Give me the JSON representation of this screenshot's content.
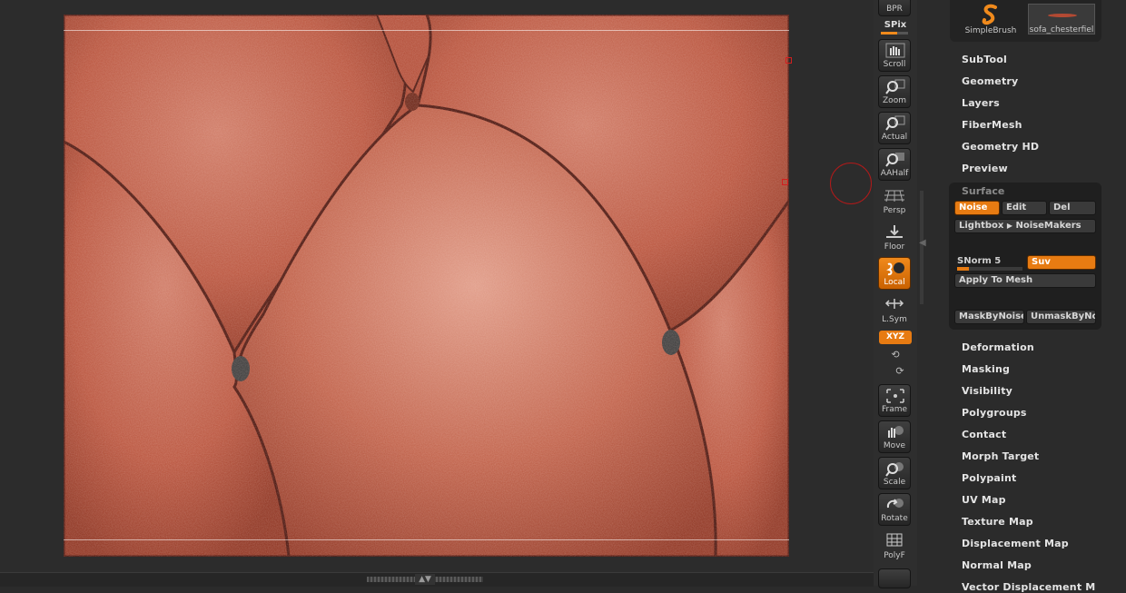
{
  "viewport": {
    "description_color": "#b8513a"
  },
  "shelf": {
    "bpr_label": "BPR",
    "spix_label": "SPix",
    "spix_level": 0.6,
    "buttons": [
      {
        "label": "Scroll",
        "icon": "hand-scroll-icon"
      },
      {
        "label": "Zoom",
        "icon": "magnifier-zoom-icon"
      },
      {
        "label": "Actual",
        "icon": "magnifier-actual-icon"
      },
      {
        "label": "AAHalf",
        "icon": "magnifier-aahalf-icon"
      },
      {
        "label": "Persp",
        "icon": "perspective-grid-icon"
      },
      {
        "label": "Floor",
        "icon": "floor-icon"
      },
      {
        "label": "Local",
        "icon": "local-transform-icon",
        "active": true
      },
      {
        "label": "L.Sym",
        "icon": "local-symmetry-icon"
      },
      {
        "label": "Frame",
        "icon": "frame-icon"
      },
      {
        "label": "Move",
        "icon": "hand-move-icon"
      },
      {
        "label": "Scale",
        "icon": "magnifier-scale-icon"
      },
      {
        "label": "Rotate",
        "icon": "rotate-icon"
      },
      {
        "label": "PolyF",
        "icon": "polyframe-grid-icon"
      }
    ],
    "xyz_label": "XYZ"
  },
  "brushes": {
    "primary": "SimpleBrush",
    "secondary": "sofa_chesterfiel"
  },
  "menu_top": [
    "SubTool",
    "Geometry",
    "Layers",
    "FiberMesh",
    "Geometry HD",
    "Preview"
  ],
  "surface": {
    "title": "Surface",
    "noise": "Noise",
    "edit": "Edit",
    "del": "Del",
    "lightbox": "Lightbox",
    "noisemakers": "NoiseMakers",
    "snorm_label": "SNorm 5",
    "snorm_level": 0.18,
    "suv": "Suv",
    "apply": "Apply To Mesh",
    "mask_by_noise": "MaskByNoise",
    "unmask_by_noise": "UnmaskByNo"
  },
  "menu_bottom": [
    "Deformation",
    "Masking",
    "Visibility",
    "Polygroups",
    "Contact",
    "Morph Target",
    "Polypaint",
    "UV Map",
    "Texture Map",
    "Displacement Map",
    "Normal Map",
    "Vector Displacement M"
  ],
  "colors": {
    "accent": "#e77b12",
    "skin": "#b8513a"
  }
}
